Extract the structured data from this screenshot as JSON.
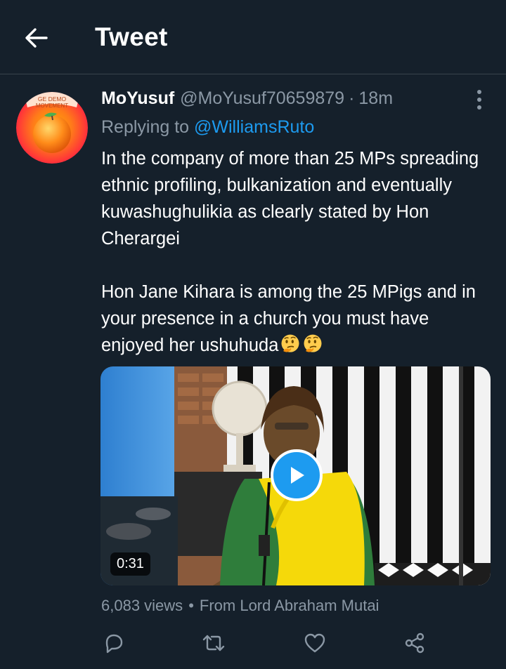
{
  "header": {
    "title": "Tweet",
    "back_icon": "arrow-left-icon"
  },
  "avatar": {
    "text_line1": "GE DEMO",
    "text_line2": "MOVEMENT",
    "ring_color": "#ff5a2a"
  },
  "tweet": {
    "display_name": "MoYusuf",
    "handle": "@MoYusuf70659879",
    "separator": "·",
    "time": "18m",
    "replying_prefix": "Replying to ",
    "replying_to": "@WilliamsRuto",
    "paragraph1": "In the company of more than 25 MPs spreading ethnic profiling, bulkanization and eventually kuwashughulikia as clearly stated by Hon Cherargei",
    "paragraph2": "Hon Jane Kihara is among the 25 MPigs and in your presence in a church you must have enjoyed her ushuhuda",
    "emojis": [
      "thinking-face-icon",
      "thinking-face-icon"
    ]
  },
  "media": {
    "type": "video",
    "duration": "0:31",
    "play_icon": "play-icon"
  },
  "meta": {
    "views": "6,083 views",
    "dot": "•",
    "source": "From Lord Abraham Mutai"
  },
  "actions": [
    "reply-icon",
    "retweet-icon",
    "like-icon",
    "share-icon"
  ],
  "colors": {
    "background": "#15202b",
    "accent": "#1d9bf0",
    "muted": "#8b98a5",
    "divider": "#38444d"
  }
}
